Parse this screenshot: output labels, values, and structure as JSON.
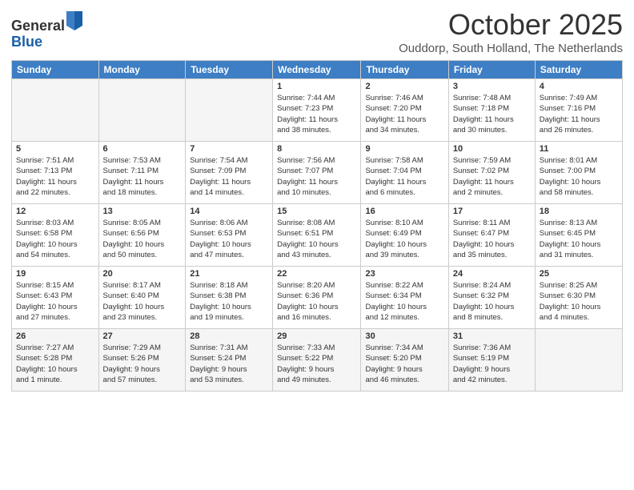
{
  "logo": {
    "general": "General",
    "blue": "Blue"
  },
  "header": {
    "month": "October 2025",
    "location": "Ouddorp, South Holland, The Netherlands"
  },
  "weekdays": [
    "Sunday",
    "Monday",
    "Tuesday",
    "Wednesday",
    "Thursday",
    "Friday",
    "Saturday"
  ],
  "weeks": [
    [
      {
        "day": "",
        "info": ""
      },
      {
        "day": "",
        "info": ""
      },
      {
        "day": "",
        "info": ""
      },
      {
        "day": "1",
        "info": "Sunrise: 7:44 AM\nSunset: 7:23 PM\nDaylight: 11 hours\nand 38 minutes."
      },
      {
        "day": "2",
        "info": "Sunrise: 7:46 AM\nSunset: 7:20 PM\nDaylight: 11 hours\nand 34 minutes."
      },
      {
        "day": "3",
        "info": "Sunrise: 7:48 AM\nSunset: 7:18 PM\nDaylight: 11 hours\nand 30 minutes."
      },
      {
        "day": "4",
        "info": "Sunrise: 7:49 AM\nSunset: 7:16 PM\nDaylight: 11 hours\nand 26 minutes."
      }
    ],
    [
      {
        "day": "5",
        "info": "Sunrise: 7:51 AM\nSunset: 7:13 PM\nDaylight: 11 hours\nand 22 minutes."
      },
      {
        "day": "6",
        "info": "Sunrise: 7:53 AM\nSunset: 7:11 PM\nDaylight: 11 hours\nand 18 minutes."
      },
      {
        "day": "7",
        "info": "Sunrise: 7:54 AM\nSunset: 7:09 PM\nDaylight: 11 hours\nand 14 minutes."
      },
      {
        "day": "8",
        "info": "Sunrise: 7:56 AM\nSunset: 7:07 PM\nDaylight: 11 hours\nand 10 minutes."
      },
      {
        "day": "9",
        "info": "Sunrise: 7:58 AM\nSunset: 7:04 PM\nDaylight: 11 hours\nand 6 minutes."
      },
      {
        "day": "10",
        "info": "Sunrise: 7:59 AM\nSunset: 7:02 PM\nDaylight: 11 hours\nand 2 minutes."
      },
      {
        "day": "11",
        "info": "Sunrise: 8:01 AM\nSunset: 7:00 PM\nDaylight: 10 hours\nand 58 minutes."
      }
    ],
    [
      {
        "day": "12",
        "info": "Sunrise: 8:03 AM\nSunset: 6:58 PM\nDaylight: 10 hours\nand 54 minutes."
      },
      {
        "day": "13",
        "info": "Sunrise: 8:05 AM\nSunset: 6:56 PM\nDaylight: 10 hours\nand 50 minutes."
      },
      {
        "day": "14",
        "info": "Sunrise: 8:06 AM\nSunset: 6:53 PM\nDaylight: 10 hours\nand 47 minutes."
      },
      {
        "day": "15",
        "info": "Sunrise: 8:08 AM\nSunset: 6:51 PM\nDaylight: 10 hours\nand 43 minutes."
      },
      {
        "day": "16",
        "info": "Sunrise: 8:10 AM\nSunset: 6:49 PM\nDaylight: 10 hours\nand 39 minutes."
      },
      {
        "day": "17",
        "info": "Sunrise: 8:11 AM\nSunset: 6:47 PM\nDaylight: 10 hours\nand 35 minutes."
      },
      {
        "day": "18",
        "info": "Sunrise: 8:13 AM\nSunset: 6:45 PM\nDaylight: 10 hours\nand 31 minutes."
      }
    ],
    [
      {
        "day": "19",
        "info": "Sunrise: 8:15 AM\nSunset: 6:43 PM\nDaylight: 10 hours\nand 27 minutes."
      },
      {
        "day": "20",
        "info": "Sunrise: 8:17 AM\nSunset: 6:40 PM\nDaylight: 10 hours\nand 23 minutes."
      },
      {
        "day": "21",
        "info": "Sunrise: 8:18 AM\nSunset: 6:38 PM\nDaylight: 10 hours\nand 19 minutes."
      },
      {
        "day": "22",
        "info": "Sunrise: 8:20 AM\nSunset: 6:36 PM\nDaylight: 10 hours\nand 16 minutes."
      },
      {
        "day": "23",
        "info": "Sunrise: 8:22 AM\nSunset: 6:34 PM\nDaylight: 10 hours\nand 12 minutes."
      },
      {
        "day": "24",
        "info": "Sunrise: 8:24 AM\nSunset: 6:32 PM\nDaylight: 10 hours\nand 8 minutes."
      },
      {
        "day": "25",
        "info": "Sunrise: 8:25 AM\nSunset: 6:30 PM\nDaylight: 10 hours\nand 4 minutes."
      }
    ],
    [
      {
        "day": "26",
        "info": "Sunrise: 7:27 AM\nSunset: 5:28 PM\nDaylight: 10 hours\nand 1 minute."
      },
      {
        "day": "27",
        "info": "Sunrise: 7:29 AM\nSunset: 5:26 PM\nDaylight: 9 hours\nand 57 minutes."
      },
      {
        "day": "28",
        "info": "Sunrise: 7:31 AM\nSunset: 5:24 PM\nDaylight: 9 hours\nand 53 minutes."
      },
      {
        "day": "29",
        "info": "Sunrise: 7:33 AM\nSunset: 5:22 PM\nDaylight: 9 hours\nand 49 minutes."
      },
      {
        "day": "30",
        "info": "Sunrise: 7:34 AM\nSunset: 5:20 PM\nDaylight: 9 hours\nand 46 minutes."
      },
      {
        "day": "31",
        "info": "Sunrise: 7:36 AM\nSunset: 5:19 PM\nDaylight: 9 hours\nand 42 minutes."
      },
      {
        "day": "",
        "info": ""
      }
    ]
  ]
}
